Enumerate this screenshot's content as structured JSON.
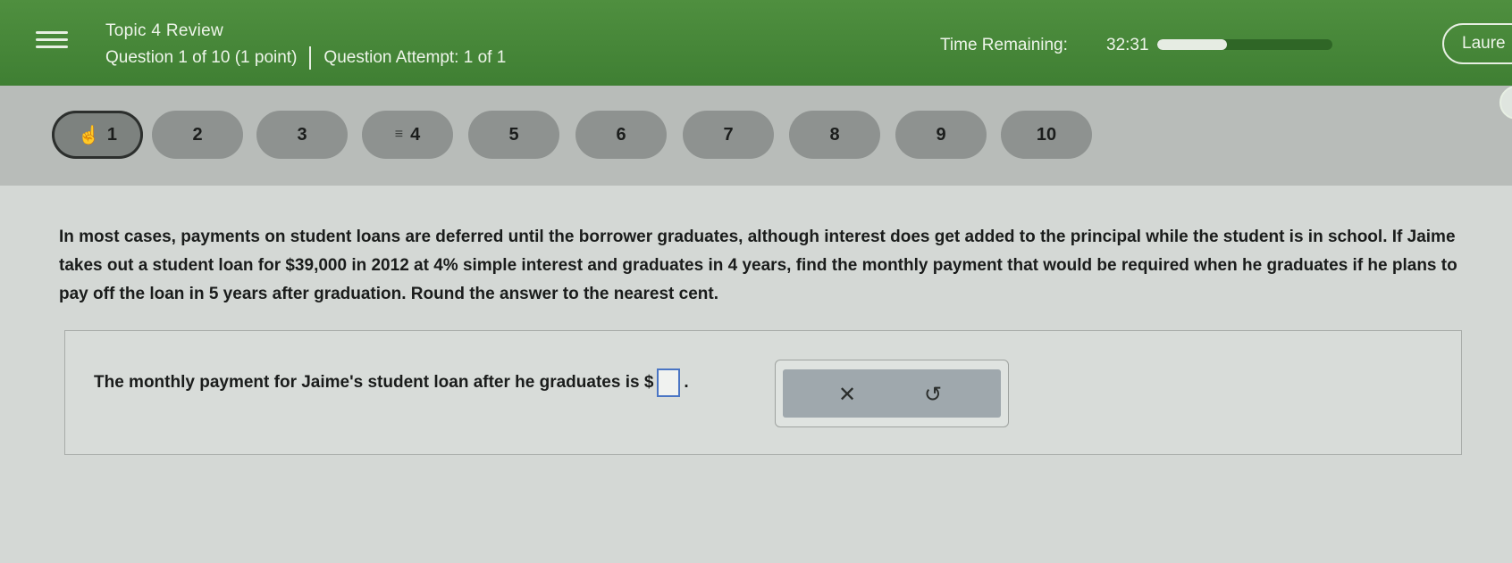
{
  "header": {
    "topic_title": "Topic 4 Review",
    "question_progress": "Question 1 of 10 (1 point)",
    "attempt": "Question Attempt: 1 of 1",
    "time_label": "Time Remaining:",
    "time_value": "32:31",
    "time_remaining_fraction": 0.4,
    "user_name": "Laure"
  },
  "nav": {
    "questions": [
      "1",
      "2",
      "3",
      "4",
      "5",
      "6",
      "7",
      "8",
      "9",
      "10"
    ],
    "active_index": 0,
    "flagged_index": 3
  },
  "question": {
    "text": "In most cases, payments on student loans are deferred until the borrower graduates, although interest does get added to the principal while the student is in school. If Jaime takes out a student loan for $39,000 in 2012 at 4% simple interest and graduates in 4 years, find the monthly payment that would be required when he graduates if he plans to pay off the loan in 5 years after graduation. Round the answer to the nearest cent."
  },
  "answer": {
    "sentence": "The monthly payment for Jaime's student loan after he graduates is $",
    "period": ".",
    "value": ""
  },
  "actions": {
    "clear_symbol": "✕",
    "undo_symbol": "↺"
  }
}
